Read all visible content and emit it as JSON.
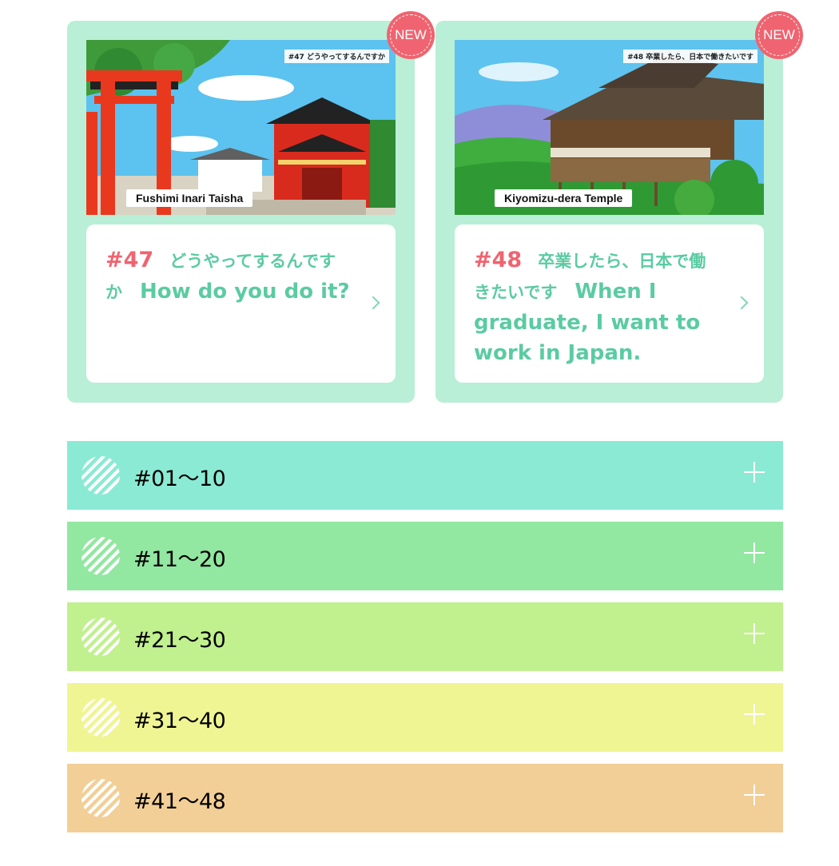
{
  "episodes": [
    {
      "badge": "NEW",
      "thumb_header": "#47 どうやってするんですか",
      "thumb_caption": "Fushimi Inari Taisha",
      "number": "#47",
      "title_jp": "どうやってするんですか",
      "title_en": "How do you do it?",
      "chevron_icon": "chevron-right-icon"
    },
    {
      "badge": "NEW",
      "thumb_header": "#48 卒業したら、日本で働きたいです",
      "thumb_caption": "Kiyomizu-dera Temple",
      "number": "#48",
      "title_jp": "卒業したら、日本で働きたいです",
      "title_en": "When I graduate, I want to work in Japan.",
      "chevron_icon": "chevron-right-icon"
    }
  ],
  "accordion": [
    {
      "label": "#01〜10",
      "color": "#8bead3",
      "icon": "plus-icon"
    },
    {
      "label": "#11〜20",
      "color": "#92e7a1",
      "icon": "plus-icon"
    },
    {
      "label": "#21〜30",
      "color": "#c1f08f",
      "icon": "plus-icon"
    },
    {
      "label": "#31〜40",
      "color": "#f0f593",
      "icon": "plus-icon"
    },
    {
      "label": "#41〜48",
      "color": "#f2cf97",
      "icon": "plus-icon"
    }
  ],
  "colors": {
    "card_bg": "#b9efd6",
    "badge": "#ef6470",
    "episode_number": "#ef6470",
    "title_text": "#5bcba2"
  }
}
